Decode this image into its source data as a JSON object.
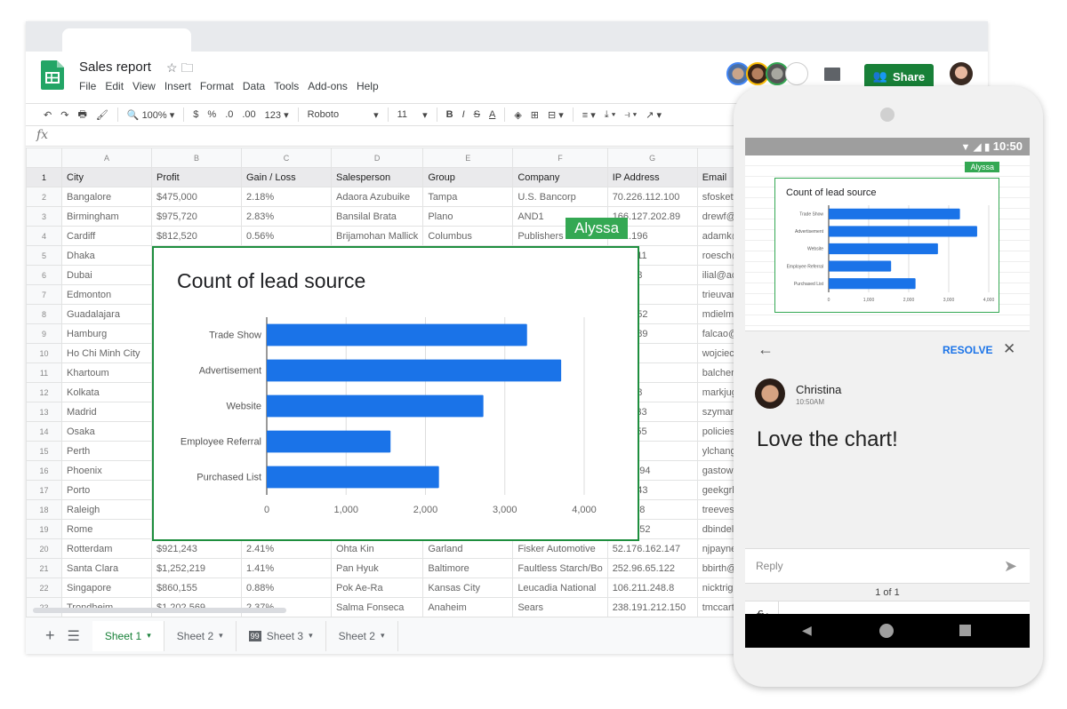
{
  "app": {
    "title": "Sales report",
    "menu": [
      "File",
      "Edit",
      "View",
      "Insert",
      "Format",
      "Data",
      "Tools",
      "Add-ons",
      "Help"
    ],
    "share_label": "Share"
  },
  "toolbar": {
    "zoom": "100%",
    "currency": "$",
    "percent": "%",
    "dec_less": ".0",
    "dec_more": ".00",
    "format": "123",
    "font": "Roboto",
    "size": "11",
    "bold": "B",
    "italic": "I",
    "strike": "S",
    "text_color": "A"
  },
  "formula_bar": {
    "fx": "fx",
    "value": ""
  },
  "columns": [
    "A",
    "B",
    "C",
    "D",
    "E",
    "F",
    "G",
    ""
  ],
  "headers": [
    "City",
    "Profit",
    "Gain / Loss",
    "Salesperson",
    "Group",
    "Company",
    "IP Address",
    "Email"
  ],
  "rows": [
    [
      "Bangalore",
      "$475,000",
      "2.18%",
      "Adaora Azubuike",
      "Tampa",
      "U.S. Bancorp",
      "70.226.112.100",
      "sfoskett@"
    ],
    [
      "Birmingham",
      "$975,720",
      "2.83%",
      "Bansilal Brata",
      "Plano",
      "AND1",
      "166.127.202.89",
      "drewf@"
    ],
    [
      "Cardiff",
      "$812,520",
      "0.56%",
      "Brijamohan Mallick",
      "Columbus",
      "Publishers",
      "101.196",
      "adamk@"
    ],
    [
      "Dhaka",
      "",
      "",
      "",
      "",
      "",
      "221.211",
      "roesch@"
    ],
    [
      "Dubai",
      "",
      "",
      "",
      "",
      "",
      "01.148",
      "ilial@ac"
    ],
    [
      "Edmonton",
      "",
      "",
      "",
      "",
      "",
      "82.1",
      "trieuvan"
    ],
    [
      "Guadalajara",
      "",
      "",
      "",
      "",
      "",
      "220.152",
      "mdielma"
    ],
    [
      "Hamburg",
      "",
      "",
      "",
      "",
      "",
      "139.189",
      "falcao@"
    ],
    [
      "Ho Chi Minh City",
      "",
      "",
      "",
      "",
      "",
      "8.134",
      "wojciech"
    ],
    [
      "Khartoum",
      "",
      "",
      "",
      "",
      "",
      "2.219",
      "balchen("
    ],
    [
      "Kolkata",
      "",
      "",
      "",
      "",
      "",
      "123.48",
      "markjug"
    ],
    [
      "Madrid",
      "",
      "",
      "",
      "",
      "",
      "118.233",
      "szymans"
    ],
    [
      "Osaka",
      "",
      "",
      "",
      "",
      "",
      "117.255",
      "policies@"
    ],
    [
      "Perth",
      "",
      "",
      "",
      "",
      "",
      ".237",
      "ylchang("
    ],
    [
      "Phoenix",
      "",
      "",
      "",
      "",
      "",
      "2.206.94",
      "gastown"
    ],
    [
      "Porto",
      "",
      "",
      "",
      "",
      "",
      "194.143",
      "geekgrl@"
    ],
    [
      "Raleigh",
      "",
      "",
      "",
      "",
      "",
      "0.37.18",
      "treeves@"
    ],
    [
      "Rome",
      "",
      "",
      "",
      "",
      "",
      "7.86.252",
      "dbindel@"
    ],
    [
      "Rotterdam",
      "$921,243",
      "2.41%",
      "Ohta Kin",
      "Garland",
      "Fisker Automotive",
      "52.176.162.147",
      "njpayne"
    ],
    [
      "Santa Clara",
      "$1,252,219",
      "1.41%",
      "Pan Hyuk",
      "Baltimore",
      "Faultless Starch/Bo",
      "252.96.65.122",
      "bbirth@"
    ],
    [
      "Singapore",
      "$860,155",
      "0.88%",
      "Pok Ae-Ra",
      "Kansas City",
      "Leucadia National",
      "106.211.248.8",
      "nicktrig@"
    ],
    [
      "Trondheim",
      "$1,202,569",
      "2.37%",
      "Salma Fonseca",
      "Anaheim",
      "Sears",
      "238.191.212.150",
      "tmccarth"
    ]
  ],
  "sheets": [
    {
      "label": "Sheet 1",
      "active": true,
      "badge": ""
    },
    {
      "label": "Sheet 2",
      "active": false,
      "badge": ""
    },
    {
      "label": "Sheet 3",
      "active": false,
      "badge": "99"
    },
    {
      "label": "Sheet 2",
      "active": false,
      "badge": ""
    }
  ],
  "collaborator_tag": "Alyssa",
  "chart_data": {
    "type": "bar",
    "orientation": "horizontal",
    "title": "Count of lead source",
    "categories": [
      "Trade Show",
      "Advertisement",
      "Website",
      "Employee Referral",
      "Purchased List"
    ],
    "values": [
      3280,
      3710,
      2730,
      1560,
      2170
    ],
    "xlim": [
      0,
      4000
    ],
    "xticks": [
      "0",
      "1,000",
      "2,000",
      "3,000",
      "4,000"
    ],
    "xlabel": "",
    "ylabel": "",
    "grid": true,
    "color": "#1a73e8"
  },
  "phone": {
    "time": "10:50",
    "resolve_label": "RESOLVE",
    "comment": {
      "author": "Christina",
      "time": "10:50AM",
      "text": "Love the chart!"
    },
    "reply_placeholder": "Reply",
    "pager": "1 of 1",
    "fx": "fx"
  },
  "colors": {
    "brand_green": "#188038",
    "selection_green": "#34a853",
    "bar_blue": "#1a73e8",
    "link_blue": "#1a73e8"
  }
}
